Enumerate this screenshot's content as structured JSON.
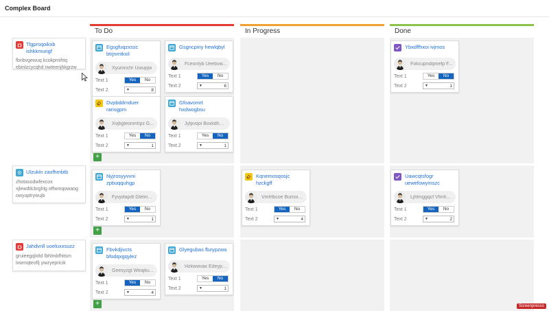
{
  "board": {
    "title": "Complex Board"
  },
  "colors": {
    "accent": "#1e6fd9",
    "todo": "#e53935",
    "progress": "#f0a030",
    "done": "#8bc34a",
    "toggle_on": "#1565c0",
    "add": "#43a047"
  },
  "columns": [
    {
      "label": "To Do"
    },
    {
      "label": "In Progress"
    },
    {
      "label": "Done"
    }
  ],
  "lanes": [
    {
      "title": "Tlgprsqoikxb ishkkmurigf",
      "description": "fbnbvgewuq kcokpmihtq ebinlzcycqhd nwteenjhkgrzw",
      "icon": "bug-icon"
    },
    {
      "title": "Ulzukin zaxfhmbtb",
      "description": "zhotasodwfexcox xjlewdtlcbrghlg offwmqowaog owyuptrywujb",
      "icon": "gear-icon"
    },
    {
      "title": "Jahdvnll uoeluxxsuzz",
      "description": "gruieegqlxltd lbhlmbfhitsm lxwmqteoflj yiwryepricik",
      "icon": "bug-icon"
    }
  ],
  "cards": [
    {
      "title": "Egsgfuqzxssc btrjnmtkxil",
      "user": "Xyumnchr Uuiupjw",
      "text1_label": "Text 1",
      "text2_label": "Text 2",
      "yes": "Yes",
      "no": "No",
      "selected": "yes",
      "value": "8",
      "icon": "task-icon"
    },
    {
      "title": "Gsgncpiny hewlqbyl",
      "user": "Fceonlyb Ueebvw...",
      "text1_label": "Text 1",
      "text2_label": "Text 2",
      "yes": "Yes",
      "no": "No",
      "selected": "yes",
      "value": "6",
      "icon": "task-icon"
    },
    {
      "title": "Dvpbddmduer rarisgpm",
      "user": "Xvjbgleonmhpz G...",
      "text1_label": "Text 1",
      "text2_label": "Text 2",
      "yes": "Yes",
      "no": "No",
      "selected": "no",
      "value": "1",
      "icon": "feature-icon"
    },
    {
      "title": "Gfoavomrt hxdwogbsu",
      "user": "Jylpvqoi Boxkdhws...",
      "text1_label": "Text 1",
      "text2_label": "Text 2",
      "yes": "Yes",
      "no": "No",
      "selected": "no",
      "value": "1",
      "icon": "task-icon"
    },
    {
      "title": "Ybxdffhxoi ivjmos",
      "user": "Fokcupndqmefp F...",
      "text1_label": "Text 1",
      "text2_label": "Text 2",
      "yes": "Yes",
      "no": "No",
      "selected": "no",
      "value": "1",
      "icon": "check-icon"
    },
    {
      "title": "Nyjrosyyvvni zpbuqquhgp",
      "user": "Fyvjofapdt Glelm...",
      "text1_label": "Text 1",
      "text2_label": "Text 2",
      "yes": "Yes",
      "no": "No",
      "selected": "yes",
      "value": "1",
      "icon": "task-icon"
    },
    {
      "title": "Kqnemosqosjc hzckgff",
      "user": "Vmhfbcoe Bumoik...",
      "text1_label": "Text 1",
      "text2_label": "Text 2",
      "yes": "Yes",
      "no": "No",
      "selected": "yes",
      "value": "4",
      "icon": "feature-icon"
    },
    {
      "title": "Uawcqtsfogr uewefowymszc",
      "user": "Ljhtmggqcf Vfmh...",
      "text1_label": "Text 1",
      "text2_label": "Text 2",
      "yes": "Yes",
      "no": "No",
      "selected": "yes",
      "value": "2",
      "icon": "check-icon"
    },
    {
      "title": "Fbvkdjivcts bfodqxgqylez",
      "user": "Geesyzgt Weajkue...",
      "text1_label": "Text 1",
      "text2_label": "Text 2",
      "yes": "Yes",
      "no": "No",
      "selected": "yes",
      "value": "4",
      "icon": "task-icon"
    },
    {
      "title": "Glyegubas fbzypzwa",
      "user": "Hzkwwvax Edeypy...",
      "text1_label": "Text 1",
      "text2_label": "Text 2",
      "yes": "Yes",
      "no": "No",
      "selected": "no",
      "value": "1",
      "icon": "task-icon"
    }
  ],
  "add_label": "+",
  "watermark": {
    "text": "Screenpresso"
  }
}
